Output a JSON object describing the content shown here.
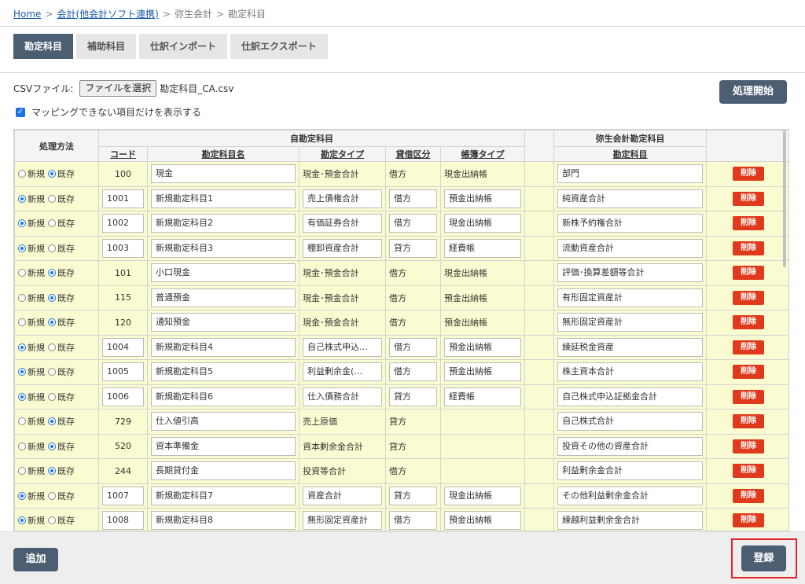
{
  "breadcrumb": {
    "home": "Home",
    "link2": "会計(他会計ソフト連携)",
    "crumb3": "弥生会計",
    "crumb4": "勘定科目",
    "separator": ">"
  },
  "tabs": [
    {
      "label": "勘定科目",
      "active": true
    },
    {
      "label": "補助科目",
      "active": false
    },
    {
      "label": "仕訳インポート",
      "active": false
    },
    {
      "label": "仕訳エクスポート",
      "active": false
    }
  ],
  "csv": {
    "label": "CSVファイル:",
    "button_label": "ファイルを選択",
    "file_name": "勘定科目_CA.csv"
  },
  "filter": {
    "checked": true,
    "label": "マッピングできない項目だけを表示する"
  },
  "process_button": "処理開始",
  "table": {
    "group_source": "自勘定科目",
    "group_target": "弥生会計勘定科目",
    "headers": {
      "method": "処理方法",
      "code": "コード",
      "name": "勘定科目名",
      "type": "勘定タイプ",
      "side": "貸借区分",
      "book": "帳簿タイプ",
      "target": "勘定科目"
    },
    "radio_new": "新規",
    "radio_existing": "既存",
    "delete_label": "削除",
    "rows": [
      {
        "mode": "existing",
        "code": "100",
        "name": "現金",
        "type": "現金･預金合計",
        "side": "借方",
        "book": "現金出納帳",
        "target": "部門"
      },
      {
        "mode": "new",
        "code": "1001",
        "name": "新規勘定科目1",
        "type": "売上債権合計",
        "side": "借方",
        "book": "預金出納帳",
        "target": "純資産合計"
      },
      {
        "mode": "new",
        "code": "1002",
        "name": "新規勘定科目2",
        "type": "有価証券合計",
        "side": "借方",
        "book": "現金出納帳",
        "target": "新株予約権合計"
      },
      {
        "mode": "new",
        "code": "1003",
        "name": "新規勘定科目3",
        "type": "棚卸資産合計",
        "side": "貸方",
        "book": "経費帳",
        "target": "流動資産合計"
      },
      {
        "mode": "existing",
        "code": "101",
        "name": "小口現金",
        "type": "現金･預金合計",
        "side": "借方",
        "book": "現金出納帳",
        "target": "評価･換算差額等合計"
      },
      {
        "mode": "existing",
        "code": "115",
        "name": "普通預金",
        "type": "現金･預金合計",
        "side": "借方",
        "book": "預金出納帳",
        "target": "有形固定資産計"
      },
      {
        "mode": "existing",
        "code": "120",
        "name": "通知預金",
        "type": "現金･預金合計",
        "side": "借方",
        "book": "預金出納帳",
        "target": "無形固定資産計"
      },
      {
        "mode": "new",
        "code": "1004",
        "name": "新規勘定科目4",
        "type": "自己株式申込…",
        "side": "借方",
        "book": "預金出納帳",
        "target": "繰延税金資産"
      },
      {
        "mode": "new",
        "code": "1005",
        "name": "新規勘定科目5",
        "type": "利益剰余金(…",
        "side": "借方",
        "book": "預金出納帳",
        "target": "株主資本合計"
      },
      {
        "mode": "new",
        "code": "1006",
        "name": "新規勘定科目6",
        "type": "仕入債務合計",
        "side": "貸方",
        "book": "経費帳",
        "target": "自己株式申込証拠金合計"
      },
      {
        "mode": "existing",
        "code": "729",
        "name": "仕入値引高",
        "type": "売上原価",
        "side": "貸方",
        "book": "",
        "target": "自己株式合計"
      },
      {
        "mode": "existing",
        "code": "520",
        "name": "資本準備金",
        "type": "資本剰余金合計",
        "side": "貸方",
        "book": "",
        "target": "投資その他の資産合計"
      },
      {
        "mode": "existing",
        "code": "244",
        "name": "長期貸付金",
        "type": "投資等合計",
        "side": "借方",
        "book": "",
        "target": "利益剰余金合計"
      },
      {
        "mode": "new",
        "code": "1007",
        "name": "新規勘定科目7",
        "type": "資産合計",
        "side": "貸方",
        "book": "現金出納帳",
        "target": "その他利益剰余金合計"
      },
      {
        "mode": "new",
        "code": "1008",
        "name": "新規勘定科目8",
        "type": "無形固定資産計",
        "side": "借方",
        "book": "預金出納帳",
        "target": "繰越利益剰余金合計"
      }
    ]
  },
  "footer": {
    "add_label": "追加",
    "save_label": "登録"
  }
}
